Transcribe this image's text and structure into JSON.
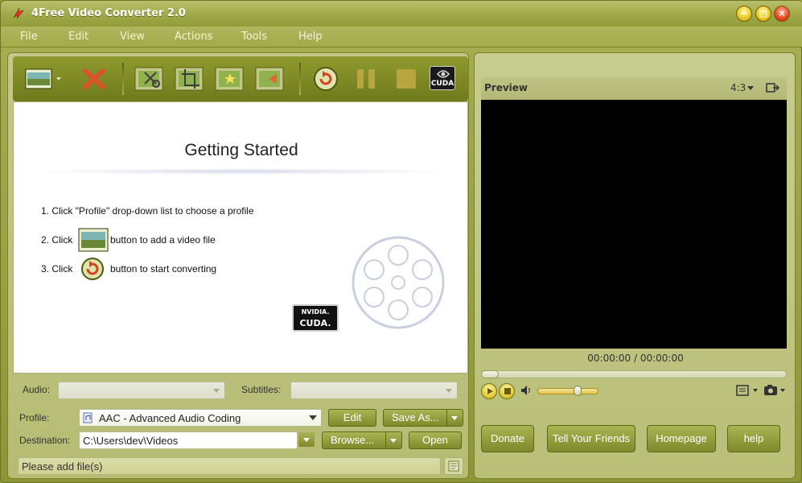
{
  "window": {
    "title": "4Free Video Converter 2.0"
  },
  "menu": [
    "File",
    "Edit",
    "View",
    "Actions",
    "Tools",
    "Help"
  ],
  "toolbar": {
    "icons": [
      "add-video-icon",
      "delete-icon",
      "trim-icon",
      "crop-icon",
      "effect-icon",
      "merge-icon",
      "convert-icon",
      "pause-icon",
      "stop-icon",
      "cuda-icon"
    ],
    "cuda_label": "CUDA"
  },
  "getting_started": {
    "title": "Getting Started",
    "step1": "1. Click \"Profile\" drop-down list to choose a profile",
    "step2_pre": "2. Click",
    "step2_post": "button to add a video file",
    "step3_pre": "3. Click",
    "step3_post": "button to start converting",
    "badge_top": "NVIDIA.",
    "badge_bottom": "CUDA."
  },
  "audio": {
    "label": "Audio:",
    "value": ""
  },
  "subtitles": {
    "label": "Subtitles:",
    "value": ""
  },
  "profile": {
    "label": "Profile:",
    "value": "AAC - Advanced Audio Coding",
    "edit": "Edit",
    "save_as": "Save As..."
  },
  "destination": {
    "label": "Destination:",
    "value": "C:\\Users\\dev\\Videos",
    "browse": "Browse...",
    "open": "Open"
  },
  "status": {
    "text": "Please add file(s)"
  },
  "preview": {
    "title": "Preview",
    "aspect": "4:3",
    "time": "00:00:00 / 00:00:00",
    "seek_fraction": 0.0,
    "volume_fraction": 0.68
  },
  "actions": {
    "donate": "Donate",
    "tell": "Tell Your Friends",
    "homepage": "Homepage",
    "help": "help"
  },
  "colors": {
    "accent": "#8f9a36",
    "button": "#93a03d",
    "panel": "#c3c88a"
  }
}
